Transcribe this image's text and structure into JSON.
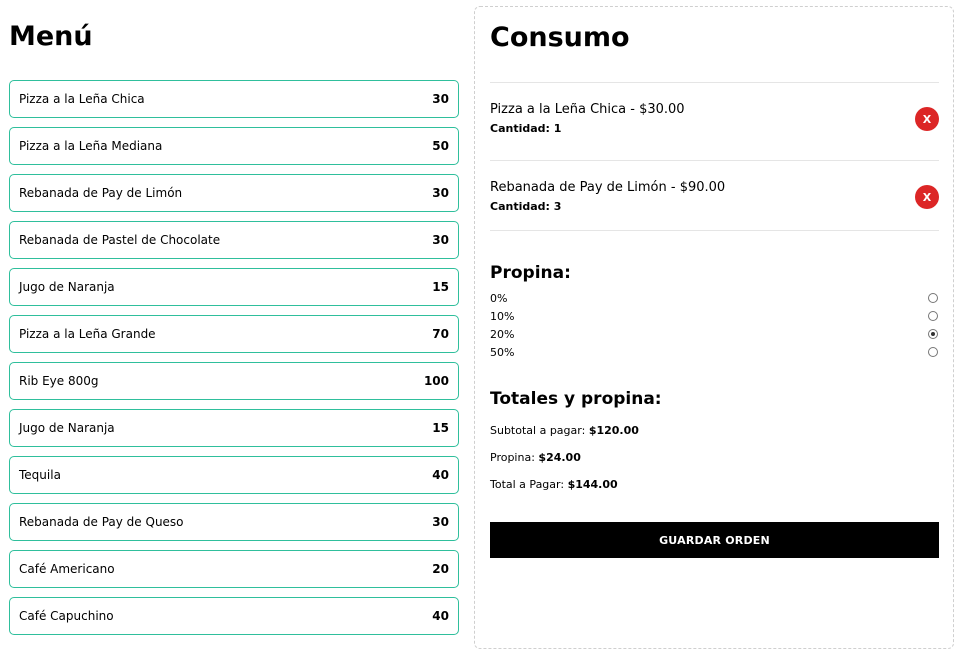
{
  "menu": {
    "title": "Menú",
    "items": [
      {
        "name": "Pizza a la Leña Chica",
        "price": "30"
      },
      {
        "name": "Pizza a la Leña Mediana",
        "price": "50"
      },
      {
        "name": "Rebanada de Pay de Limón",
        "price": "30"
      },
      {
        "name": "Rebanada de Pastel de Chocolate",
        "price": "30"
      },
      {
        "name": "Jugo de Naranja",
        "price": "15"
      },
      {
        "name": "Pizza a la Leña Grande",
        "price": "70"
      },
      {
        "name": "Rib Eye 800g",
        "price": "100"
      },
      {
        "name": "Jugo de Naranja",
        "price": "15"
      },
      {
        "name": "Tequila",
        "price": "40"
      },
      {
        "name": "Rebanada de Pay de Queso",
        "price": "30"
      },
      {
        "name": "Café Americano",
        "price": "20"
      },
      {
        "name": "Café Capuchino",
        "price": "40"
      }
    ]
  },
  "order": {
    "title": "Consumo",
    "items": [
      {
        "description": "Pizza a la Leña Chica - $30.00",
        "quantity_label": "Cantidad: 1",
        "remove_label": "X"
      },
      {
        "description": "Rebanada de Pay de Limón - $90.00",
        "quantity_label": "Cantidad: 3",
        "remove_label": "X"
      }
    ]
  },
  "tip": {
    "title": "Propina:",
    "options": [
      {
        "label": "0%",
        "selected": false
      },
      {
        "label": "10%",
        "selected": false
      },
      {
        "label": "20%",
        "selected": true
      },
      {
        "label": "50%",
        "selected": false
      }
    ]
  },
  "totals": {
    "title": "Totales y propina:",
    "subtotal_label": "Subtotal a pagar:",
    "subtotal_value": "$120.00",
    "tip_label": "Propina:",
    "tip_value": "$24.00",
    "total_label": "Total a Pagar:",
    "total_value": "$144.00"
  },
  "actions": {
    "save_label": "GUARDAR ORDEN"
  },
  "colors": {
    "menu_item_border": "#2fbf9c",
    "remove_button": "#dc2626",
    "save_button": "#000000"
  }
}
